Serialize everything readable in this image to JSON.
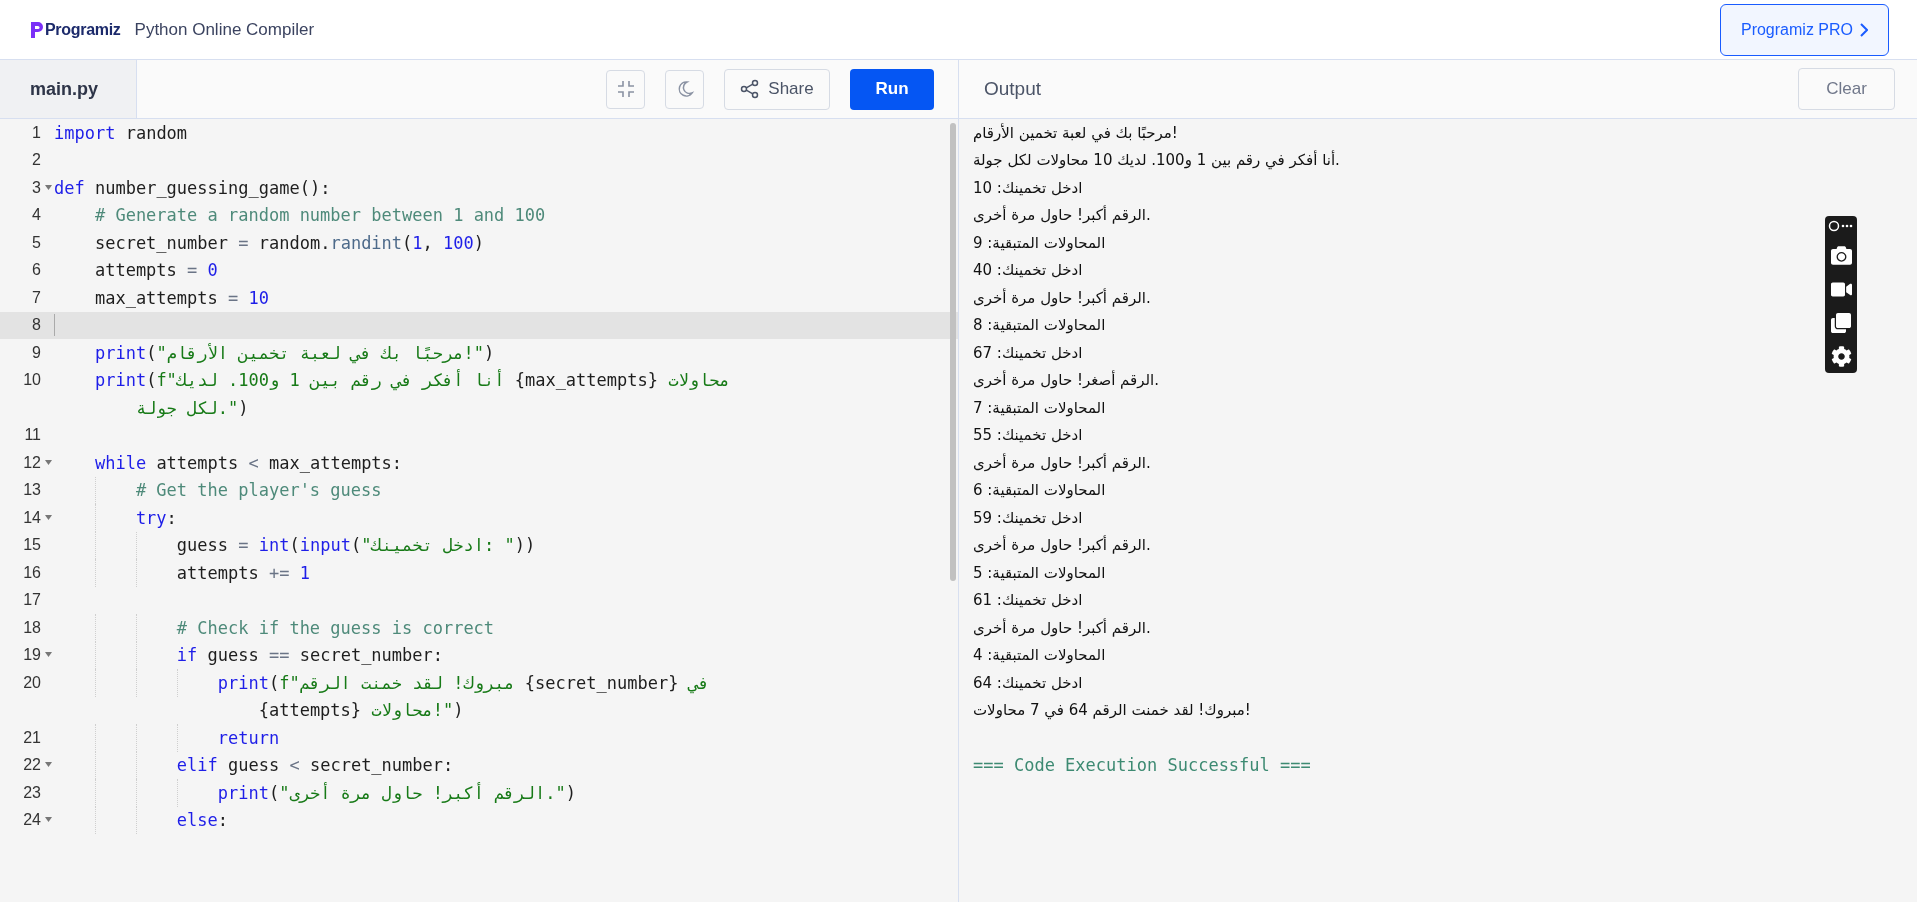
{
  "header": {
    "brand": "Programiz",
    "title": "Python Online Compiler",
    "pro_button": "Programiz PRO"
  },
  "editor": {
    "tab": {
      "label": "main.py",
      "selected": true
    },
    "share_button": "Share",
    "run_button": "Run",
    "lines": [
      {
        "n": "1",
        "fold": false,
        "highlighted": false,
        "text": "import random"
      },
      {
        "n": "2",
        "fold": false,
        "highlighted": false
      },
      {
        "n": "3",
        "fold": true,
        "highlighted": false,
        "text": "def number_guessing_game():"
      },
      {
        "n": "4",
        "fold": false,
        "highlighted": false,
        "text": "    # Generate a random number between 1 and 100"
      },
      {
        "n": "5",
        "fold": false,
        "highlighted": false,
        "text": "    secret_number = random.randint(1, 100)"
      },
      {
        "n": "6",
        "fold": false,
        "highlighted": false,
        "text": "    attempts = 0"
      },
      {
        "n": "7",
        "fold": false,
        "highlighted": false,
        "text": "    max_attempts = 10"
      },
      {
        "n": "8",
        "fold": false,
        "highlighted": true
      },
      {
        "n": "9",
        "fold": false,
        "highlighted": false,
        "text": "    print(\"مرحبًا بك في لعبة تخمين الأرقام!\")"
      },
      {
        "n": "10",
        "fold": false,
        "highlighted": false,
        "text": "    print(f\"أنا أفكر في رقم بين 1 و100. لديك {max_attempts} محاولات",
        "wrap": "        لكل جولة.\")"
      },
      {
        "n": "11",
        "fold": false,
        "highlighted": false
      },
      {
        "n": "12",
        "fold": true,
        "highlighted": false,
        "text": "    while attempts < max_attempts:"
      },
      {
        "n": "13",
        "fold": false,
        "highlighted": false,
        "text": "        # Get the player's guess"
      },
      {
        "n": "14",
        "fold": true,
        "highlighted": false,
        "text": "        try:"
      },
      {
        "n": "15",
        "fold": false,
        "highlighted": false,
        "text": "            guess = int(input(\"ادخل تخمينك: \"))"
      },
      {
        "n": "16",
        "fold": false,
        "highlighted": false,
        "text": "            attempts += 1"
      },
      {
        "n": "17",
        "fold": false,
        "highlighted": false
      },
      {
        "n": "18",
        "fold": false,
        "highlighted": false,
        "text": "            # Check if the guess is correct"
      },
      {
        "n": "19",
        "fold": true,
        "highlighted": false,
        "text": "            if guess == secret_number:"
      },
      {
        "n": "20",
        "fold": false,
        "highlighted": false,
        "text": "                print(f\"مبروك! لقد خمنت الرقم {secret_number} في",
        "wrap": "                    {attempts} محاولات!\")"
      },
      {
        "n": "21",
        "fold": false,
        "highlighted": false,
        "text": "                return"
      },
      {
        "n": "22",
        "fold": true,
        "highlighted": false,
        "text": "            elif guess < secret_number:"
      },
      {
        "n": "23",
        "fold": false,
        "highlighted": false,
        "text": "                print(\"الرقم أكبر! حاول مرة أخرى.\")"
      },
      {
        "n": "24",
        "fold": true,
        "highlighted": false,
        "text": "            else:"
      }
    ]
  },
  "output": {
    "title": "Output",
    "clear_button": "Clear",
    "lines": [
      "مرحبًا بك في لعبة تخمين الأرقام!",
      "أنا أفكر في رقم بين 1 و100. لديك 10 محاولات لكل جولة.",
      "ادخل تخمينك: 10",
      "الرقم أكبر! حاول مرة أخرى.",
      "المحاولات المتبقية: 9",
      "ادخل تخمينك: 40",
      "الرقم أكبر! حاول مرة أخرى.",
      "المحاولات المتبقية: 8",
      "ادخل تخمينك: 67",
      "الرقم أصغر! حاول مرة أخرى.",
      "المحاولات المتبقية: 7",
      "ادخل تخمينك: 55",
      "الرقم أكبر! حاول مرة أخرى.",
      "المحاولات المتبقية: 6",
      "ادخل تخمينك: 59",
      "الرقم أكبر! حاول مرة أخرى.",
      "المحاولات المتبقية: 5",
      "ادخل تخمينك: 61",
      "الرقم أكبر! حاول مرة أخرى.",
      "المحاولات المتبقية: 4",
      "ادخل تخمينك: 64",
      "مبروك! لقد خمنت الرقم 64 في 7 محاولات!"
    ],
    "status": "=== Code Execution Successful ==="
  }
}
